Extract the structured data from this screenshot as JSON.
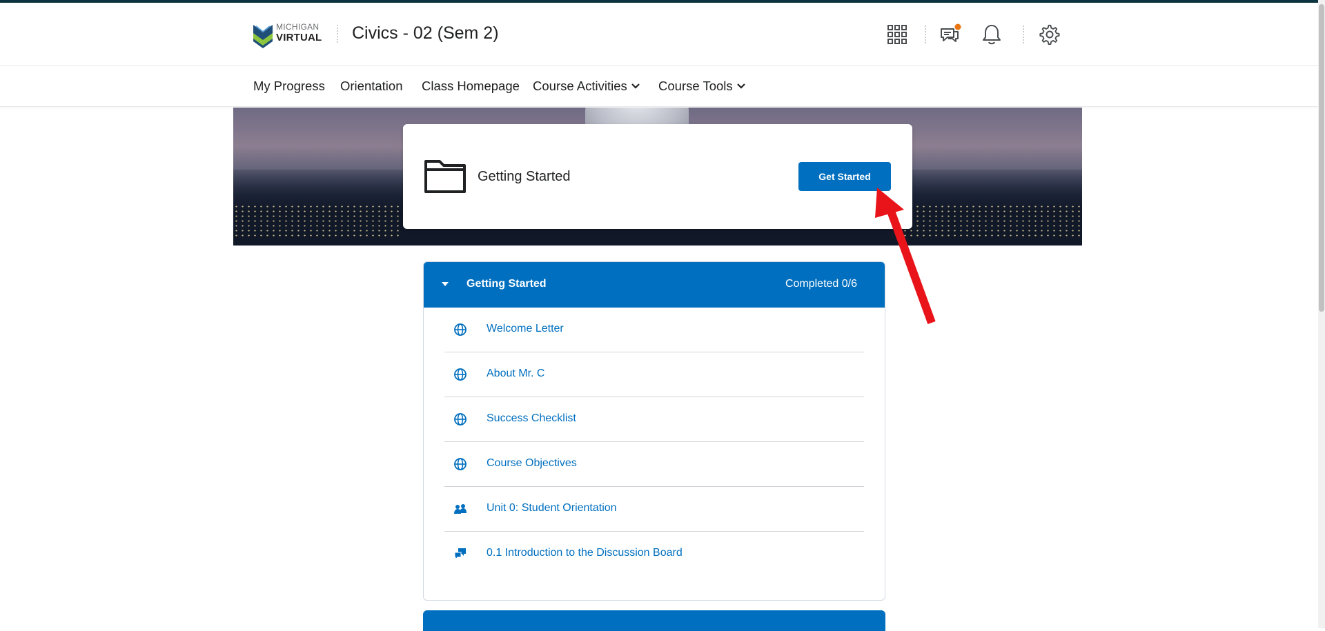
{
  "header": {
    "logo": {
      "line1": "MICHIGAN",
      "line2": "VIRTUAL",
      "icon": "michigan-virtual-logo"
    },
    "course_title": "Civics - 02 (Sem 2)",
    "icons": [
      "waffle-grid-icon",
      "messages-icon",
      "bell-icon",
      "gear-icon"
    ],
    "notification_dot_color": "#e87511"
  },
  "nav": {
    "items": [
      {
        "label": "My Progress",
        "dropdown": false
      },
      {
        "label": "Orientation",
        "dropdown": false
      },
      {
        "label": "Class Homepage",
        "dropdown": false
      },
      {
        "label": "Course Activities",
        "dropdown": true
      },
      {
        "label": "Course Tools",
        "dropdown": true
      }
    ]
  },
  "hero": {
    "card_title": "Getting Started",
    "card_icon": "folder-icon",
    "button_label": "Get Started"
  },
  "module": {
    "title": "Getting Started",
    "status": "Completed 0/6",
    "items": [
      {
        "label": "Welcome Letter",
        "icon": "globe-icon"
      },
      {
        "label": "About Mr. C",
        "icon": "globe-icon"
      },
      {
        "label": "Success Checklist",
        "icon": "globe-icon"
      },
      {
        "label": "Course Objectives",
        "icon": "globe-icon"
      },
      {
        "label": "Unit 0: Student Orientation",
        "icon": "group-icon"
      },
      {
        "label": "0.1 Introduction to the Discussion Board",
        "icon": "discussion-icon"
      }
    ]
  },
  "colors": {
    "accent": "#006fbf",
    "annotation_arrow": "#e8141a"
  }
}
